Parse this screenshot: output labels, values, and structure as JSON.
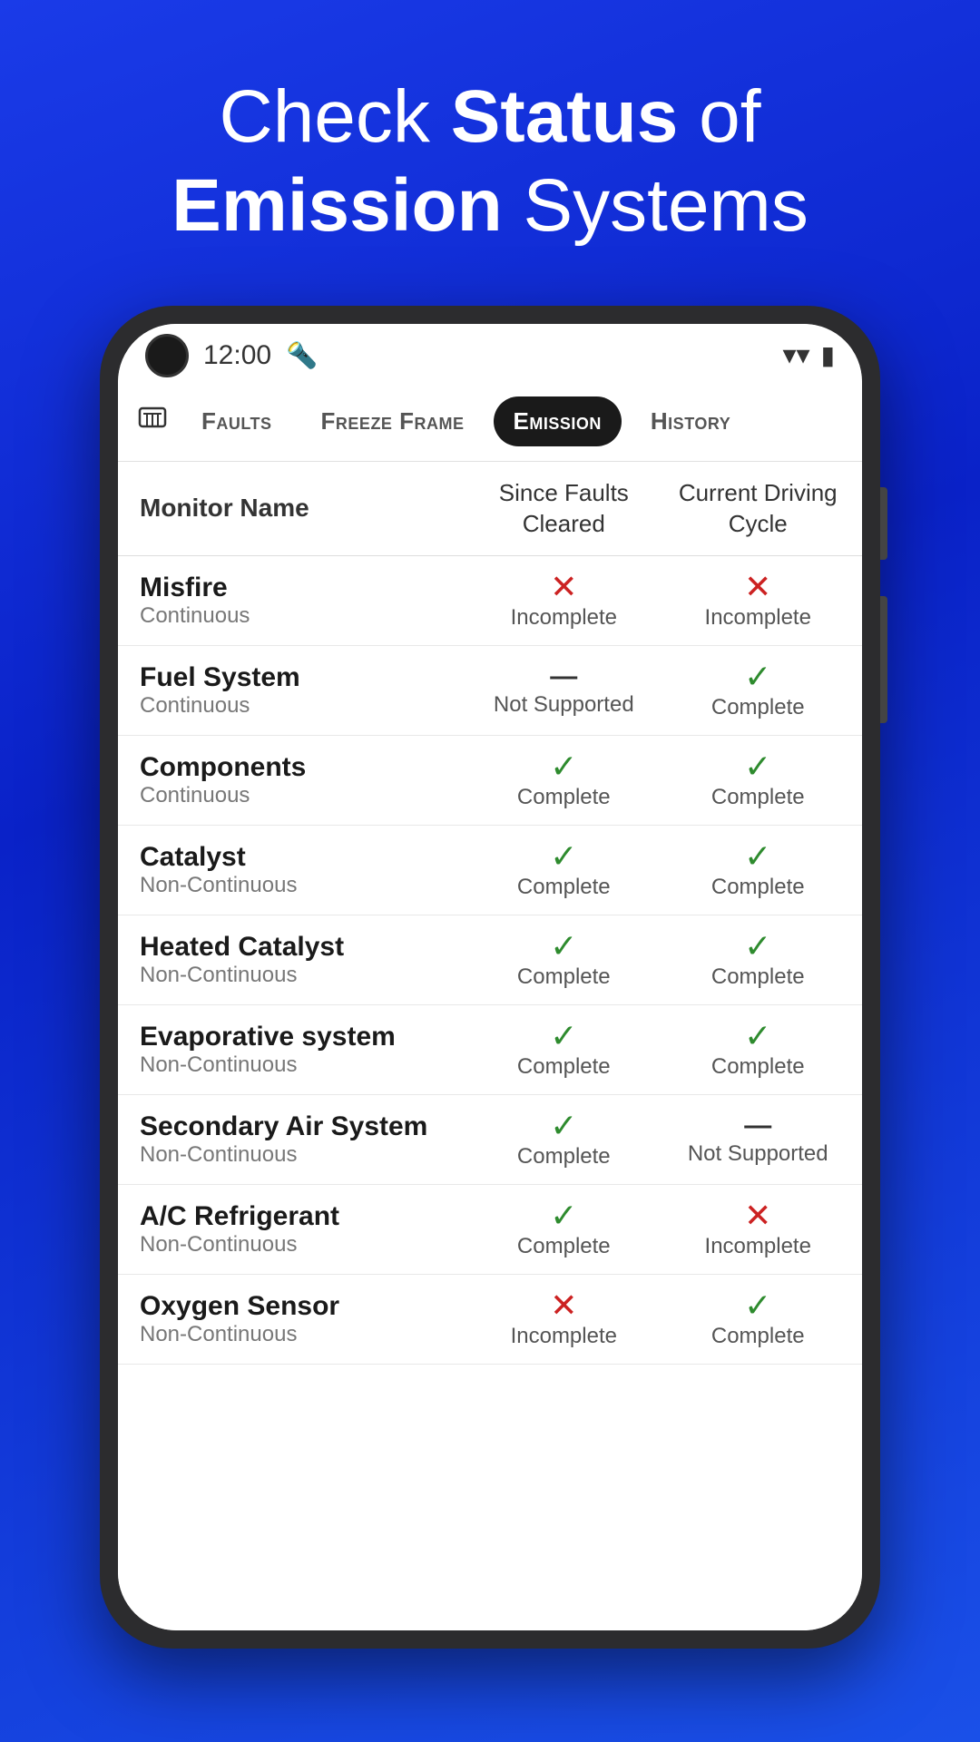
{
  "hero": {
    "line1": "Check ",
    "bold1": "Status",
    "line1b": " of",
    "line2bold": "Emission",
    "line2": " Systems"
  },
  "phone": {
    "status_bar": {
      "time": "12:00"
    },
    "tabs": [
      {
        "label": "Faults",
        "active": false
      },
      {
        "label": "Freeze Frame",
        "active": false
      },
      {
        "label": "Emission",
        "active": true
      },
      {
        "label": "History",
        "active": false
      }
    ],
    "table": {
      "headers": {
        "col1": "Monitor Name",
        "col2": "Since Faults Cleared",
        "col3": "Current Driving Cycle"
      },
      "rows": [
        {
          "name": "Misfire",
          "type": "Continuous",
          "col2_icon": "incomplete",
          "col2_text": "Incomplete",
          "col3_icon": "incomplete",
          "col3_text": "Incomplete"
        },
        {
          "name": "Fuel System",
          "type": "Continuous",
          "col2_icon": "not-supported",
          "col2_text": "Not Supported",
          "col3_icon": "complete",
          "col3_text": "Complete"
        },
        {
          "name": "Components",
          "type": "Continuous",
          "col2_icon": "complete",
          "col2_text": "Complete",
          "col3_icon": "complete",
          "col3_text": "Complete"
        },
        {
          "name": "Catalyst",
          "type": "Non-Continuous",
          "col2_icon": "complete",
          "col2_text": "Complete",
          "col3_icon": "complete",
          "col3_text": "Complete"
        },
        {
          "name": "Heated Catalyst",
          "type": "Non-Continuous",
          "col2_icon": "complete",
          "col2_text": "Complete",
          "col3_icon": "complete",
          "col3_text": "Complete"
        },
        {
          "name": "Evaporative system",
          "type": "Non-Continuous",
          "col2_icon": "complete",
          "col2_text": "Complete",
          "col3_icon": "complete",
          "col3_text": "Complete"
        },
        {
          "name": "Secondary Air System",
          "type": "Non-Continuous",
          "col2_icon": "complete",
          "col2_text": "Complete",
          "col3_icon": "not-supported",
          "col3_text": "Not Supported"
        },
        {
          "name": "A/C Refrigerant",
          "type": "Non-Continuous",
          "col2_icon": "complete",
          "col2_text": "Complete",
          "col3_icon": "incomplete",
          "col3_text": "Incomplete"
        },
        {
          "name": "Oxygen Sensor",
          "type": "Non-Continuous",
          "col2_icon": "incomplete",
          "col2_text": "Incomplete",
          "col3_icon": "complete",
          "col3_text": "Complete"
        }
      ]
    }
  }
}
